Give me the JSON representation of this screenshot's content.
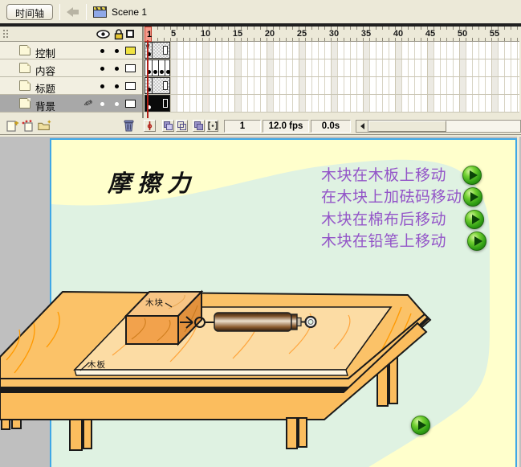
{
  "topbar": {
    "panel_tab": "时间轴",
    "scene_label": "Scene 1"
  },
  "timeline": {
    "header_columns": [
      "show-hide",
      "lock-unlock",
      "outline-view"
    ],
    "layers": [
      {
        "name": "控制",
        "outline_color": "#F0E342",
        "selected": false,
        "frame_pattern": "action-span"
      },
      {
        "name": "内容",
        "outline_color": "#FFFFFF",
        "selected": false,
        "frame_pattern": "four-keyframes"
      },
      {
        "name": "标题",
        "outline_color": "#FFFFFF",
        "selected": false,
        "frame_pattern": "span"
      },
      {
        "name": "背景",
        "outline_color": "#FFFFFF",
        "selected": true,
        "frame_pattern": "selected-span"
      }
    ],
    "ruler_numbers": [
      1,
      5,
      10,
      15,
      20,
      25,
      30,
      35,
      40,
      45,
      50,
      55
    ],
    "current_frame_label": "1",
    "status": {
      "current_frame": "1",
      "frame_rate": "12.0 fps",
      "elapsed_time": "0.0s"
    }
  },
  "stage": {
    "title": "摩擦力",
    "menu": [
      {
        "label": "木块在木板上移动"
      },
      {
        "label": "在木块上加砝码移动"
      },
      {
        "label": "木块在棉布后移动"
      },
      {
        "label": "木块在铅笔上移动"
      }
    ],
    "diagram_labels": {
      "block": "木块",
      "board": "木板"
    },
    "colors": {
      "stage_background": "#FFFFCC",
      "background_blob": "#DFF2E2",
      "menu_text": "#9355C8",
      "stage_border": "#3FA7E6",
      "table_wood": "#FBBD5E",
      "tabletop_wood": "#FBC268",
      "board_wood": "#FCDCA4",
      "block_front": "#F2A24C",
      "block_top": "#F8C584",
      "block_right": "#E2913C",
      "wood_grain": "#FF9900",
      "button_green": "#2F9E14",
      "playhead_red": "#B22018"
    }
  }
}
